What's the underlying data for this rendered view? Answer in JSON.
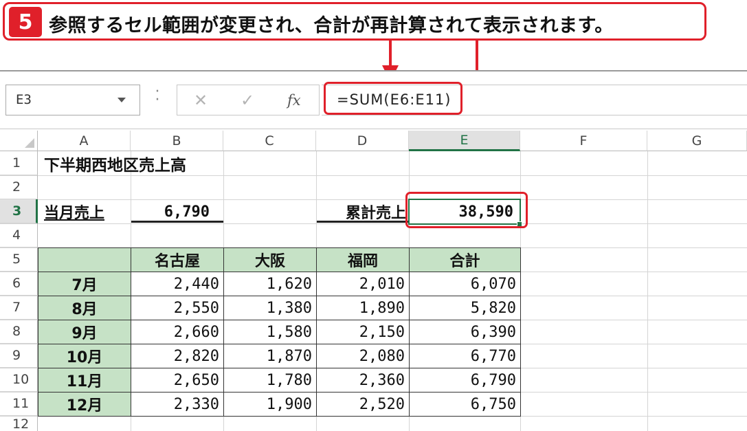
{
  "callout": {
    "step": "5",
    "text": "参照するセル範囲が変更され、合計が再計算されて表示されます。"
  },
  "formula_bar": {
    "name_box": "E3",
    "cancel_icon": "✕",
    "enter_icon": "✓",
    "fx_label": "fx",
    "formula": "=SUM(E6:E11)"
  },
  "columns": [
    "A",
    "B",
    "C",
    "D",
    "E",
    "F",
    "G"
  ],
  "selected_column": "E",
  "rows": [
    "1",
    "2",
    "3",
    "4",
    "5",
    "6",
    "7",
    "8",
    "9",
    "10",
    "11",
    "12"
  ],
  "selected_row": "3",
  "sheet": {
    "title": "下半期西地区売上高",
    "month_label": "当月売上",
    "month_value": "6,790",
    "cumulative_label": "累計売上",
    "cumulative_value": "38,590",
    "table_headers": [
      "",
      "名古屋",
      "大阪",
      "福岡",
      "合計"
    ],
    "table_rows": [
      {
        "month": "7月",
        "values": [
          "2,440",
          "1,620",
          "2,010",
          "6,070"
        ]
      },
      {
        "month": "8月",
        "values": [
          "2,550",
          "1,380",
          "1,890",
          "5,820"
        ]
      },
      {
        "month": "9月",
        "values": [
          "2,660",
          "1,580",
          "2,150",
          "6,390"
        ]
      },
      {
        "month": "10月",
        "values": [
          "2,820",
          "1,870",
          "2,080",
          "6,770"
        ]
      },
      {
        "month": "11月",
        "values": [
          "2,650",
          "1,780",
          "2,360",
          "6,790"
        ]
      },
      {
        "month": "12月",
        "values": [
          "2,330",
          "1,900",
          "2,520",
          "6,750"
        ]
      }
    ]
  },
  "colors": {
    "accent_red": "#e0202a",
    "excel_green": "#217346",
    "header_fill": "#c6e2c6"
  }
}
